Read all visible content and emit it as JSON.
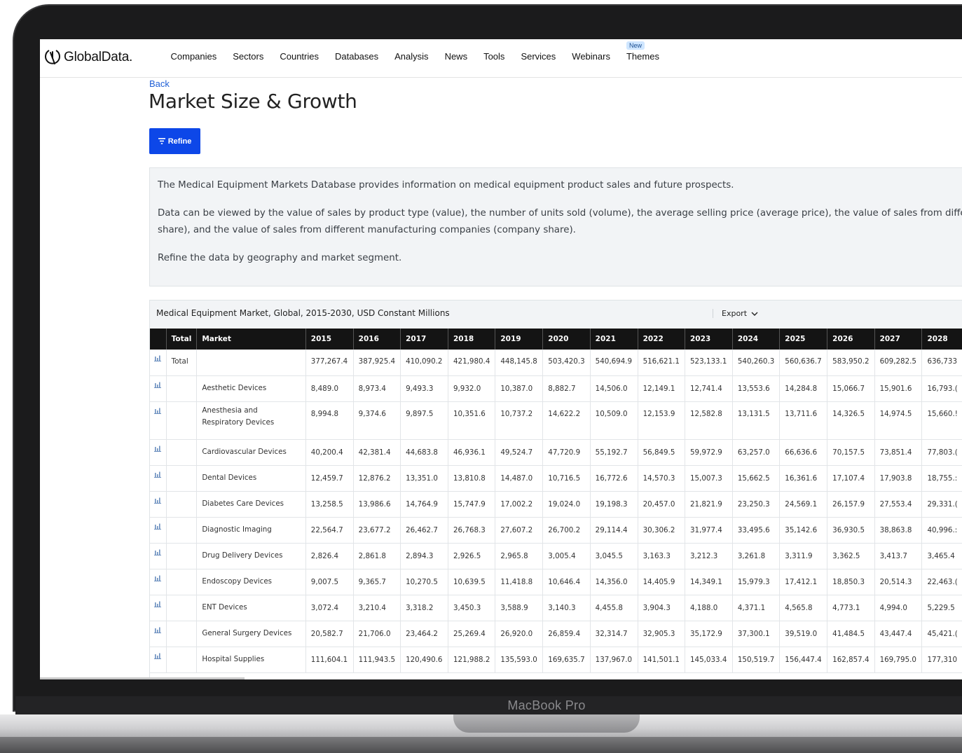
{
  "device": {
    "label": "MacBook Pro"
  },
  "nav": {
    "logo_text": "GlobalData.",
    "items": [
      "Companies",
      "Sectors",
      "Countries",
      "Databases",
      "Analysis",
      "News",
      "Tools",
      "Services",
      "Webinars",
      "Themes"
    ],
    "themes_badge": "New"
  },
  "page": {
    "back": "Back",
    "title": "Market Size & Growth",
    "refine": "Refine"
  },
  "info": {
    "p1": "The Medical Equipment Markets Database provides information on medical equipment product sales and future prospects.",
    "p2a": "Data can be viewed by the value of sales by product type (value), the number of units sold (volume), the average selling price (average price), the value of sales from different c",
    "p2b": "share), and the value of sales from different manufacturing companies (company share).",
    "p3": "Refine the data by geography and market segment."
  },
  "table": {
    "caption": "Medical Equipment Market, Global, 2015-2030, USD Constant Millions",
    "export": "Export",
    "headers": [
      "Total",
      "Market",
      "2015",
      "2016",
      "2017",
      "2018",
      "2019",
      "2020",
      "2021",
      "2022",
      "2023",
      "2024",
      "2025",
      "2026",
      "2027",
      "2028"
    ],
    "rows": [
      {
        "total": "Total",
        "market": "",
        "values": [
          "377,267.4",
          "387,925.4",
          "410,090.2",
          "421,980.4",
          "448,145.8",
          "503,420.3",
          "540,694.9",
          "516,621.1",
          "523,133.1",
          "540,260.3",
          "560,636.7",
          "583,950.2",
          "609,282.5",
          "636,733"
        ]
      },
      {
        "total": "",
        "market": "Aesthetic Devices",
        "values": [
          "8,489.0",
          "8,973.4",
          "9,493.3",
          "9,932.0",
          "10,387.0",
          "8,882.7",
          "14,506.0",
          "12,149.1",
          "12,741.4",
          "13,553.6",
          "14,284.8",
          "15,066.7",
          "15,901.6",
          "16,793.("
        ]
      },
      {
        "total": "",
        "market": "Anesthesia and Respiratory Devices",
        "values": [
          "8,994.8",
          "9,374.6",
          "9,897.5",
          "10,351.6",
          "10,737.2",
          "14,622.2",
          "10,509.0",
          "12,153.9",
          "12,582.8",
          "13,131.5",
          "13,711.6",
          "14,326.5",
          "14,974.5",
          "15,660.!"
        ]
      },
      {
        "total": "",
        "market": "Cardiovascular Devices",
        "values": [
          "40,200.4",
          "42,381.4",
          "44,683.8",
          "46,936.1",
          "49,524.7",
          "47,720.9",
          "55,192.7",
          "56,849.5",
          "59,972.9",
          "63,257.0",
          "66,636.6",
          "70,157.5",
          "73,851.4",
          "77,803.("
        ]
      },
      {
        "total": "",
        "market": "Dental Devices",
        "values": [
          "12,459.7",
          "12,876.2",
          "13,351.0",
          "13,810.8",
          "14,487.0",
          "10,716.5",
          "16,772.6",
          "14,570.3",
          "15,007.3",
          "15,662.5",
          "16,361.6",
          "17,107.4",
          "17,903.8",
          "18,755.:"
        ]
      },
      {
        "total": "",
        "market": "Diabetes Care Devices",
        "values": [
          "13,258.5",
          "13,986.6",
          "14,764.9",
          "15,747.9",
          "17,002.2",
          "19,024.0",
          "19,198.3",
          "20,457.0",
          "21,821.9",
          "23,250.3",
          "24,569.1",
          "26,157.9",
          "27,553.4",
          "29,331.("
        ]
      },
      {
        "total": "",
        "market": "Diagnostic Imaging",
        "values": [
          "22,564.7",
          "23,677.2",
          "26,462.7",
          "26,768.3",
          "27,607.2",
          "26,700.2",
          "29,114.4",
          "30,306.2",
          "31,977.4",
          "33,495.6",
          "35,142.6",
          "36,930.5",
          "38,863.8",
          "40,996.:"
        ]
      },
      {
        "total": "",
        "market": "Drug Delivery Devices",
        "values": [
          "2,826.4",
          "2,861.8",
          "2,894.3",
          "2,926.5",
          "2,965.8",
          "3,005.4",
          "3,045.5",
          "3,163.3",
          "3,212.3",
          "3,261.8",
          "3,311.9",
          "3,362.5",
          "3,413.7",
          "3,465.4"
        ]
      },
      {
        "total": "",
        "market": "Endoscopy Devices",
        "values": [
          "9,007.5",
          "9,365.7",
          "10,270.5",
          "10,639.5",
          "11,418.8",
          "10,646.4",
          "14,356.0",
          "14,405.9",
          "14,349.1",
          "15,979.3",
          "17,412.1",
          "18,850.3",
          "20,514.3",
          "22,463.("
        ]
      },
      {
        "total": "",
        "market": "ENT Devices",
        "values": [
          "3,072.4",
          "3,210.4",
          "3,318.2",
          "3,450.3",
          "3,588.9",
          "3,140.3",
          "4,455.8",
          "3,904.3",
          "4,188.0",
          "4,371.1",
          "4,565.8",
          "4,773.1",
          "4,994.0",
          "5,229.5"
        ]
      },
      {
        "total": "",
        "market": "General Surgery Devices",
        "values": [
          "20,582.7",
          "21,706.0",
          "23,464.2",
          "25,269.4",
          "26,920.0",
          "26,859.4",
          "32,314.7",
          "32,905.3",
          "35,172.9",
          "37,300.1",
          "39,519.0",
          "41,484.5",
          "43,447.4",
          "45,421.("
        ]
      },
      {
        "total": "",
        "market": "Hospital Supplies",
        "values": [
          "111,604.1",
          "111,943.5",
          "120,490.6",
          "121,988.2",
          "135,593.0",
          "169,635.7",
          "137,967.0",
          "141,501.1",
          "145,033.4",
          "150,519.7",
          "156,447.4",
          "162,857.4",
          "169,795.0",
          "177,310"
        ]
      }
    ]
  },
  "colors": {
    "brand_blue": "#0d47e8",
    "link": "#1f5fd6",
    "header_bg": "#141414",
    "panel_bg": "#f2f4f6"
  },
  "icons": [
    "globaldata-logo-icon",
    "filter-icon",
    "chevron-down-icon",
    "bar-chart-icon"
  ]
}
